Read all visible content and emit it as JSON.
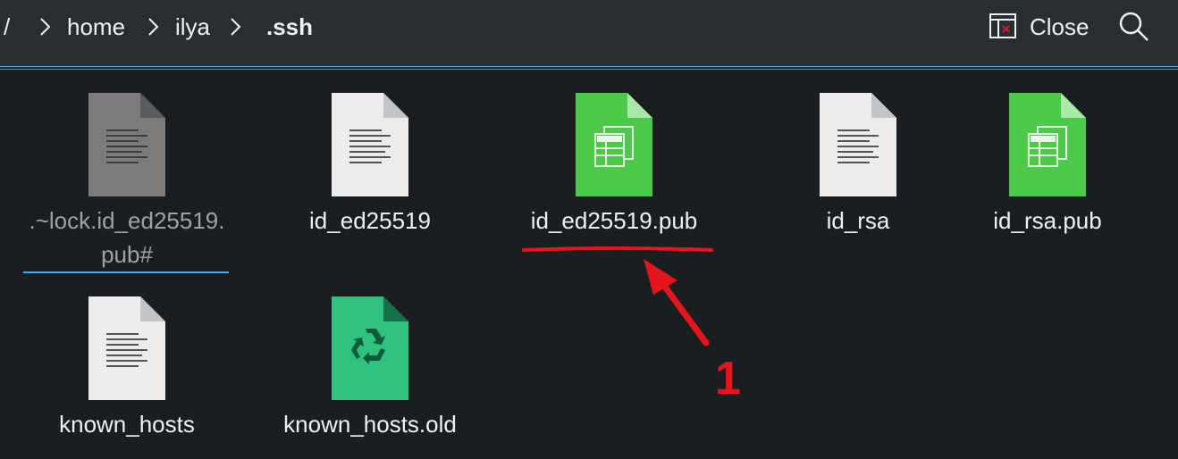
{
  "breadcrumb": {
    "root": "/",
    "segments": [
      "home",
      "ilya",
      ".ssh"
    ]
  },
  "toolbar": {
    "close_label": "Close",
    "close_icon": "close-view-icon",
    "search_icon": "search-icon"
  },
  "files": [
    {
      "name": ".~lock.id_ed25519.\npub#",
      "type": "lock-file",
      "icon": "text-file-gray-icon"
    },
    {
      "name": "id_ed25519",
      "type": "text",
      "icon": "text-file-icon"
    },
    {
      "name": "id_ed25519.pub",
      "type": "spreadsheet",
      "icon": "spreadsheet-file-icon"
    },
    {
      "name": "id_rsa",
      "type": "text",
      "icon": "text-file-icon"
    },
    {
      "name": "id_rsa.pub",
      "type": "spreadsheet",
      "icon": "spreadsheet-file-icon"
    },
    {
      "name": "known_hosts",
      "type": "text",
      "icon": "text-file-icon"
    },
    {
      "name": "known_hosts.old",
      "type": "backup",
      "icon": "recycle-file-icon"
    }
  ],
  "annotation": {
    "number": "1",
    "color": "#e5161b"
  },
  "colors": {
    "background": "#1b1e21",
    "toolbar": "#2a2e32",
    "accent": "#3daee9",
    "spreadsheet_green": "#4cc94a",
    "backup_green": "#2ec27e"
  }
}
